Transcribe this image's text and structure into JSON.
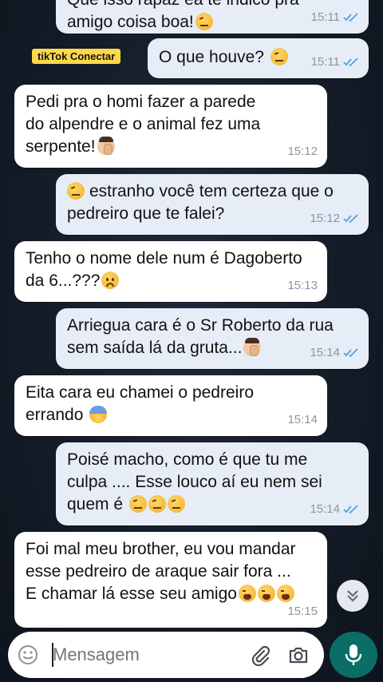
{
  "watermark": {
    "label": "tikTok Conectar"
  },
  "messages": [
    {
      "id": "m1",
      "direction": "out",
      "text": "Que isso rapaz ea te indico pra\namigo coisa boa!",
      "emojis": [
        "face-raised-eyebrow"
      ],
      "time": "15:11",
      "read": true
    },
    {
      "id": "m2",
      "direction": "out",
      "text": "O que houve?",
      "emojis": [
        "face-raised-eyebrow"
      ],
      "time": "15:11",
      "read": true
    },
    {
      "id": "m3",
      "direction": "in",
      "text": "Pedi pra o homi fazer a parede\ndo alpendre e o animal fez uma\nserpente!",
      "emojis": [
        "man-facepalming"
      ],
      "time": "15:12"
    },
    {
      "id": "m4",
      "direction": "out",
      "text": "estranho você tem certeza que o\npedreiro que te falei?",
      "emojis_before": [
        "face-raised-eyebrow"
      ],
      "time": "15:12",
      "read": true
    },
    {
      "id": "m5",
      "direction": "in",
      "text": "Tenho o nome dele num é Dagoberto\nda 6...???",
      "emojis": [
        "worried-face"
      ],
      "time": "15:13"
    },
    {
      "id": "m6",
      "direction": "out",
      "text": "Arriegua cara é o Sr Roberto da rua\nsem saída lá da gruta...",
      "emojis": [
        "man-facepalming"
      ],
      "time": "15:14",
      "read": true
    },
    {
      "id": "m7",
      "direction": "in",
      "text": "Eita cara eu chamei o pedreiro\nerrando",
      "emojis": [
        "anxious-face-with-sweat"
      ],
      "time": "15:14"
    },
    {
      "id": "m8",
      "direction": "out",
      "text": "Poisé macho, como é que tu me\nculpa .... Esse louco aí eu nem sei\nquem é",
      "emojis": [
        "face-raised-eyebrow",
        "face-raised-eyebrow",
        "face-raised-eyebrow"
      ],
      "time": "15:14",
      "read": true
    },
    {
      "id": "m9",
      "direction": "in",
      "text": "Foi mal meu brother, eu vou mandar\nesse pedreiro de araque sair fora ...\nE chamar lá esse seu amigo",
      "emojis": [
        "weary-face",
        "weary-face",
        "weary-face"
      ],
      "time": "15:15"
    }
  ],
  "composer": {
    "placeholder": "Mensagem",
    "emoji_icon": "smiley-icon",
    "attach_icon": "paperclip-icon",
    "camera_icon": "camera-icon",
    "mic_icon": "microphone-icon"
  },
  "scroll_button": {
    "icon": "double-chevron-down-icon"
  },
  "colors": {
    "incoming_bubble": "#ffffff",
    "outgoing_bubble": "#e6edf6",
    "read_ticks": "#4fa3e0",
    "mic_button": "#0b6e66",
    "watermark_bg": "#ffd84a"
  }
}
